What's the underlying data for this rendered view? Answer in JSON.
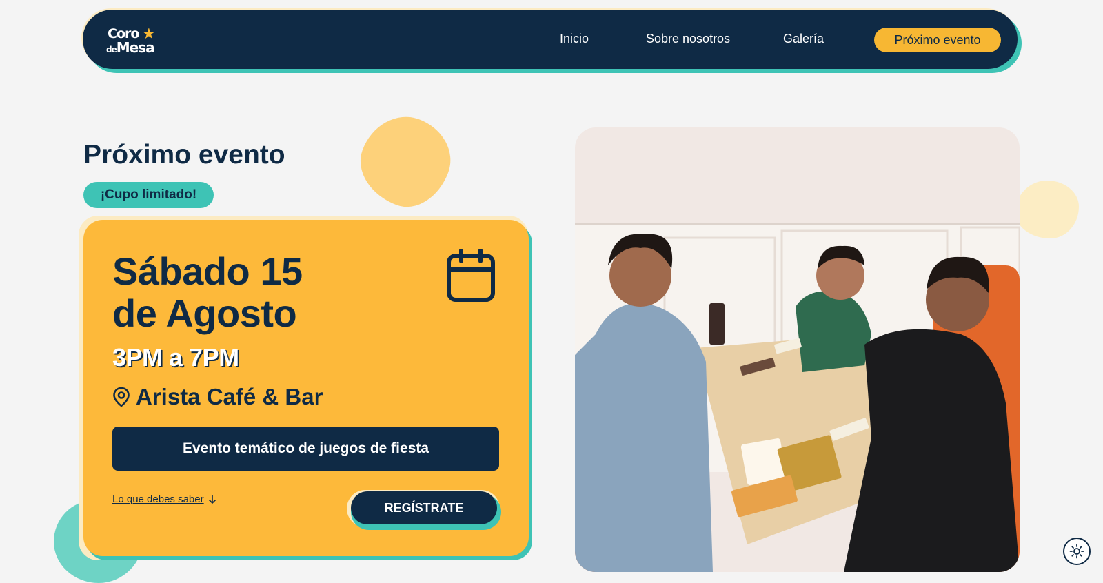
{
  "header": {
    "logo_line1": "Coro",
    "logo_de": "de",
    "logo_line2": "Mesa",
    "nav_items": [
      "Inicio",
      "Sobre nosotros",
      "Galería"
    ],
    "cta": "Próximo evento"
  },
  "hero": {
    "title": "Próximo evento",
    "badge": "¡Cupo limitado!",
    "date_line1": "Sábado 15",
    "date_line2": "de Agosto",
    "time": "3PM a 7PM",
    "venue": "Arista Café & Bar",
    "theme": "Evento temático de juegos de fiesta",
    "more_link": "Lo que debes saber",
    "register": "REGÍSTRATE"
  },
  "icons": {
    "calendar": "calendar-icon",
    "location": "map-pin-icon",
    "arrow": "arrow-down-icon",
    "theme_toggle": "sun-icon"
  },
  "colors": {
    "navy": "#0f2a45",
    "yellow": "#fdb93a",
    "teal": "#3ec3b5",
    "cream": "#fcebc3"
  }
}
